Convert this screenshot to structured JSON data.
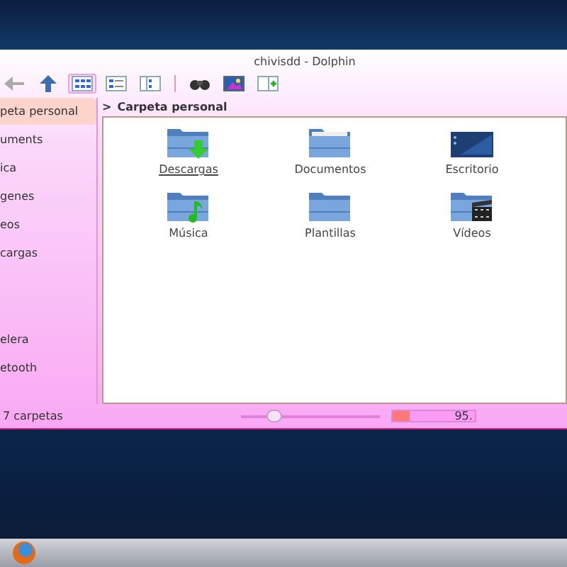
{
  "window": {
    "title": "chivisdd - Dolphin"
  },
  "toolbar": [
    {
      "kind": "back",
      "selected": false
    },
    {
      "kind": "up",
      "selected": false
    },
    {
      "kind": "icons",
      "selected": true
    },
    {
      "kind": "details",
      "selected": false
    },
    {
      "kind": "columns",
      "selected": false
    },
    {
      "kind": "find",
      "selected": false
    },
    {
      "kind": "preview",
      "selected": false
    },
    {
      "kind": "split",
      "selected": false
    }
  ],
  "sidebar": {
    "items": [
      {
        "label": "peta personal",
        "selected": true
      },
      {
        "label": "uments",
        "selected": false
      },
      {
        "label": "ica",
        "selected": false
      },
      {
        "label": "genes",
        "selected": false
      },
      {
        "label": "eos",
        "selected": false
      },
      {
        "label": "cargas",
        "selected": false
      },
      {
        "label": "elera",
        "selected": false
      },
      {
        "label": "etooth",
        "selected": false
      }
    ]
  },
  "breadcrumb": {
    "arrow": ">",
    "label": "Carpeta personal"
  },
  "files": [
    {
      "name": "Descargas",
      "kind": "downloads",
      "hovered": true
    },
    {
      "name": "Documentos",
      "kind": "documents",
      "hovered": false
    },
    {
      "name": "Escritorio",
      "kind": "desktop",
      "hovered": false
    },
    {
      "name": "Música",
      "kind": "music",
      "hovered": false
    },
    {
      "name": "Plantillas",
      "kind": "templates",
      "hovered": false
    },
    {
      "name": "Vídeos",
      "kind": "videos",
      "hovered": false
    }
  ],
  "status_bar": {
    "text": "7 carpetas",
    "zoom": {
      "level": 0.2
    },
    "free_space": {
      "level": 0.2,
      "reading": "95."
    }
  },
  "taskbar": {
    "apps": [
      {
        "kind": "browser"
      }
    ]
  }
}
